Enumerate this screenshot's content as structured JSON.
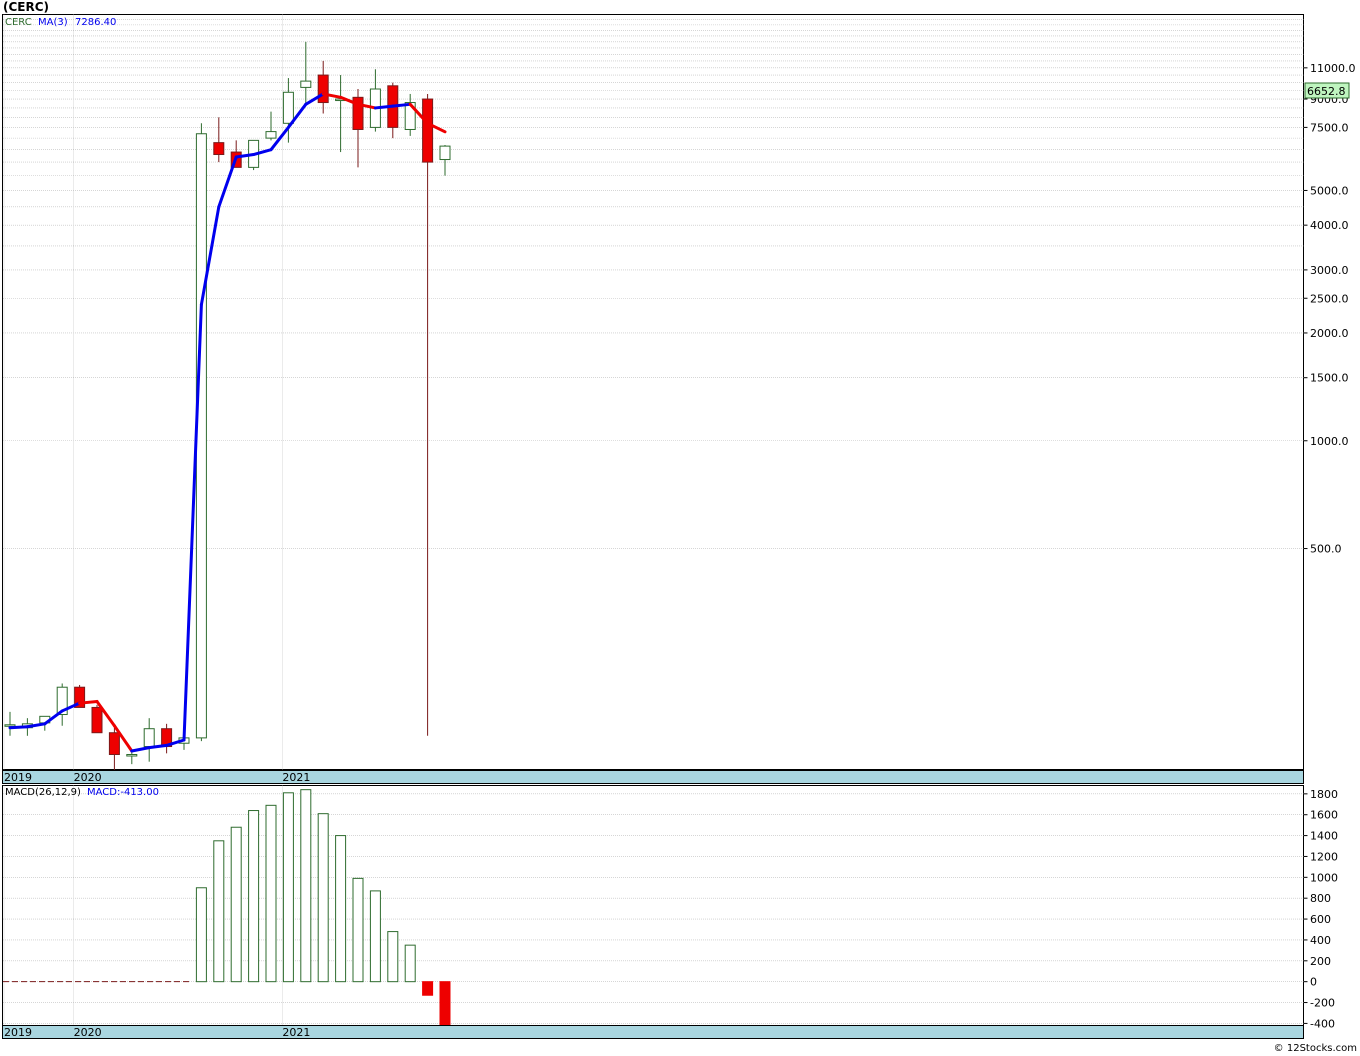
{
  "ticker_title": "(CERC)",
  "watermark": "© 12Stocks.com",
  "colors": {
    "up": "#2e6b2e",
    "down": "#ee0000",
    "ma_up": "#0000ee",
    "ma_down": "#ee0000",
    "axis_band": "#a9d6e0",
    "last_price_bg": "#bff5bf",
    "grid": "#bdbdbd"
  },
  "chart_data": [
    {
      "type": "candlestick",
      "legend": {
        "symbol": "CERC",
        "ma_label": "MA(3)",
        "ma_value": "7286.40"
      },
      "last_price_label": "6652.8",
      "y_scale": "log",
      "ylim": [
        120,
        15500
      ],
      "y_ticks": [
        {
          "v": 11000,
          "label": "11000.0"
        },
        {
          "v": 9000,
          "label": "9000.0"
        },
        {
          "v": 7500,
          "label": "7500.0"
        },
        {
          "v": 5000,
          "label": "5000.0"
        },
        {
          "v": 4000,
          "label": "4000.0"
        },
        {
          "v": 3000,
          "label": "3000.0"
        },
        {
          "v": 2500,
          "label": "2500.0"
        },
        {
          "v": 2000,
          "label": "2000.0"
        },
        {
          "v": 1500,
          "label": "1500.0"
        },
        {
          "v": 1000,
          "label": "1000.0"
        },
        {
          "v": 500,
          "label": "500.0"
        }
      ],
      "x_labels": [
        {
          "i": 0,
          "label": "2019"
        },
        {
          "i": 4,
          "label": "2020"
        },
        {
          "i": 16,
          "label": "2021"
        }
      ],
      "candles": [
        {
          "o": 161,
          "h": 175,
          "l": 150,
          "c": 161
        },
        {
          "o": 158,
          "h": 168,
          "l": 150,
          "c": 162
        },
        {
          "o": 163,
          "h": 170,
          "l": 155,
          "c": 170
        },
        {
          "o": 172,
          "h": 210,
          "l": 160,
          "c": 205
        },
        {
          "o": 205,
          "h": 208,
          "l": 180,
          "c": 180
        },
        {
          "o": 180,
          "h": 183,
          "l": 153,
          "c": 153
        },
        {
          "o": 153,
          "h": 158,
          "l": 120,
          "c": 133
        },
        {
          "o": 133,
          "h": 136,
          "l": 125,
          "c": 133
        },
        {
          "o": 140,
          "h": 168,
          "l": 127,
          "c": 157
        },
        {
          "o": 157,
          "h": 162,
          "l": 134,
          "c": 140
        },
        {
          "o": 143,
          "h": 154,
          "l": 137,
          "c": 148
        },
        {
          "o": 148,
          "h": 7700,
          "l": 145,
          "c": 7200
        },
        {
          "o": 6800,
          "h": 8000,
          "l": 6000,
          "c": 6300
        },
        {
          "o": 6400,
          "h": 6900,
          "l": 5800,
          "c": 5800
        },
        {
          "o": 5800,
          "h": 6800,
          "l": 5700,
          "c": 6900
        },
        {
          "o": 7000,
          "h": 8300,
          "l": 6900,
          "c": 7300
        },
        {
          "o": 7700,
          "h": 10300,
          "l": 6800,
          "c": 9400
        },
        {
          "o": 9700,
          "h": 13000,
          "l": 8700,
          "c": 10100
        },
        {
          "o": 10500,
          "h": 11500,
          "l": 8200,
          "c": 8800
        },
        {
          "o": 9000,
          "h": 10500,
          "l": 6400,
          "c": 9000
        },
        {
          "o": 9100,
          "h": 9600,
          "l": 5800,
          "c": 7400
        },
        {
          "o": 7500,
          "h": 10900,
          "l": 7300,
          "c": 9600
        },
        {
          "o": 9800,
          "h": 10000,
          "l": 7000,
          "c": 7500
        },
        {
          "o": 7400,
          "h": 9300,
          "l": 7100,
          "c": 8800
        },
        {
          "o": 9000,
          "h": 9300,
          "l": 150,
          "c": 6000
        },
        {
          "o": 6100,
          "h": 6700,
          "l": 5500,
          "c": 6650
        }
      ],
      "ma": [
        158,
        159,
        162,
        176,
        185,
        187,
        160,
        136,
        139,
        141,
        146,
        2400,
        4500,
        6200,
        6300,
        6500,
        7500,
        8700,
        9300,
        9100,
        8700,
        8500,
        8600,
        8700,
        7700,
        7290
      ],
      "ma_colors": [
        "down",
        "up",
        "up",
        "up",
        "up",
        "down",
        "down",
        "down",
        "up",
        "up",
        "up",
        "up",
        "up",
        "up",
        "up",
        "up",
        "up",
        "up",
        "up",
        "down",
        "down",
        "down",
        "up",
        "up",
        "down",
        "down"
      ]
    },
    {
      "type": "bar",
      "legend": {
        "label": "MACD(26,12,9)",
        "value_label": "MACD:-413.00"
      },
      "ylim": [
        -420,
        1880
      ],
      "y_ticks": [
        1800,
        1600,
        1400,
        1200,
        1000,
        800,
        600,
        400,
        200,
        0,
        -200,
        -400
      ],
      "x_labels": [
        {
          "i": 0,
          "label": "2019"
        },
        {
          "i": 4,
          "label": "2020"
        },
        {
          "i": 16,
          "label": "2021"
        }
      ],
      "values": [
        0,
        0,
        0,
        0,
        0,
        0,
        0,
        0,
        0,
        0,
        0,
        900,
        1350,
        1480,
        1640,
        1690,
        1810,
        1840,
        1610,
        1400,
        990,
        870,
        480,
        350,
        -130,
        -413
      ]
    }
  ]
}
